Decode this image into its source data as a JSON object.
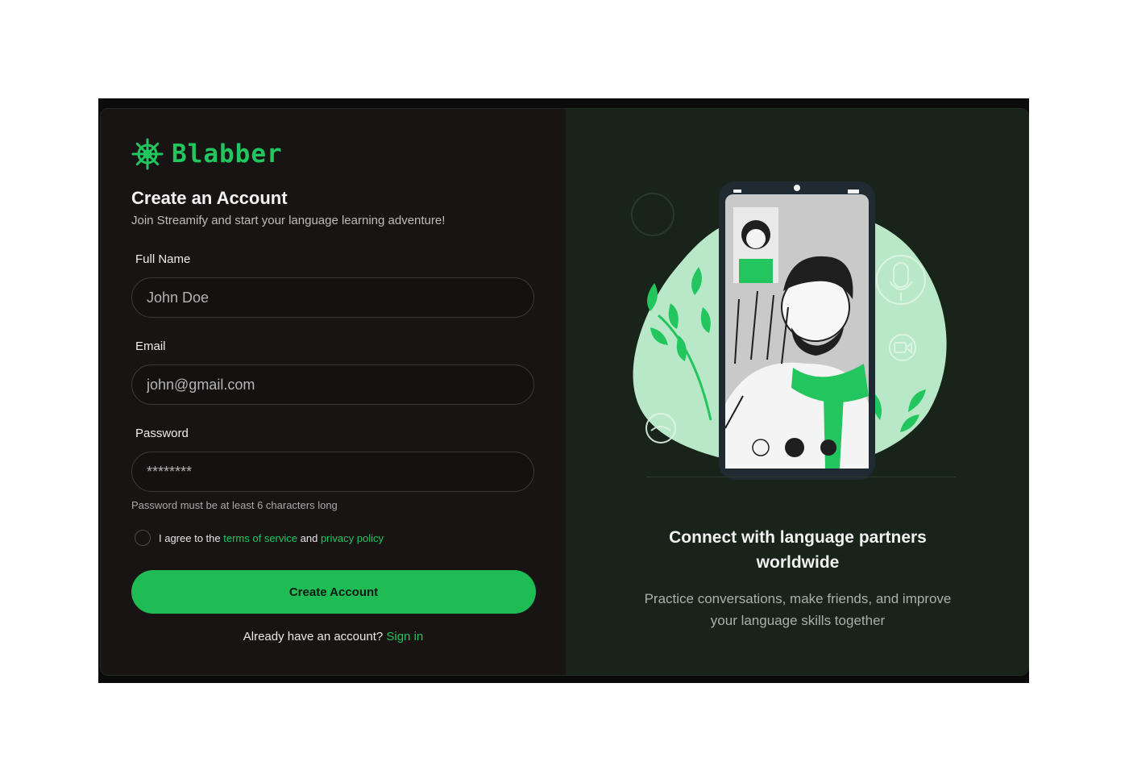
{
  "brand": {
    "name": "Blabber",
    "icon": "ship-wheel-icon",
    "accent": "#22c55e"
  },
  "signup": {
    "title": "Create an Account",
    "subtitle": "Join Streamify and start your language learning adventure!",
    "fields": {
      "full_name": {
        "label": "Full Name",
        "placeholder": "John Doe"
      },
      "email": {
        "label": "Email",
        "placeholder": "john@gmail.com"
      },
      "password": {
        "label": "Password",
        "placeholder": "********",
        "hint": "Password must be at least 6 characters long"
      }
    },
    "agree": {
      "prefix": "I agree to the",
      "terms_link": "terms of service",
      "and": "and",
      "privacy_link": "privacy policy"
    },
    "submit_label": "Create Account",
    "signin_prompt": "Already have an account?",
    "signin_link": "Sign in"
  },
  "promo": {
    "title_line1": "Connect with language partners",
    "title_line2": "worldwide",
    "text_line1": "Practice conversations, make friends, and improve",
    "text_line2": "your language skills together",
    "icons": [
      "video-icon",
      "microphone-icon",
      "hang-up-icon"
    ]
  },
  "colors": {
    "left_bg": "#181414",
    "right_bg": "#182319",
    "button_bg": "#1fbb55"
  }
}
